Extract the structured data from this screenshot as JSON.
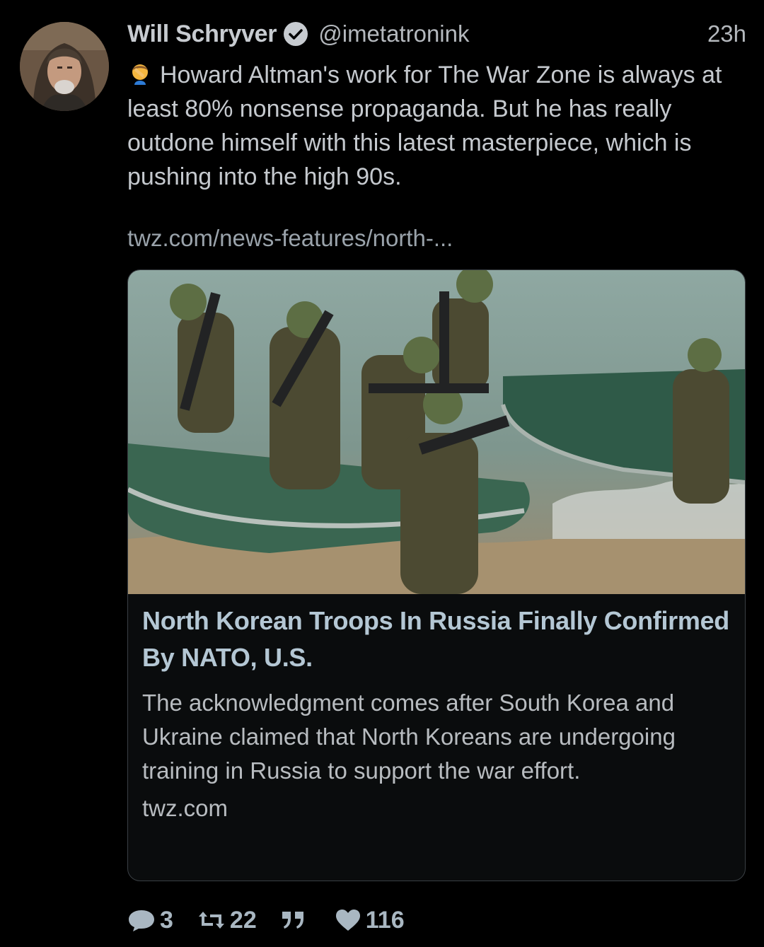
{
  "author": {
    "display_name": "Will Schryver",
    "handle": "@imetatronink",
    "verified": true,
    "avatar_icon": "avatar-photo"
  },
  "timestamp": "23h",
  "tweet": {
    "emoji_icon": "facepalm-emoji",
    "text": "Howard Altman's work for The War Zone is always at least 80% nonsense propaganda. But he has really outdone himself with this latest masterpiece, which is pushing into the high 90s.",
    "link": "twz.com/news-features/north-..."
  },
  "card": {
    "image_icon": "soldiers-landing-boats-photo",
    "headline": "North Korean Troops In Russia Finally Confirmed By NATO, U.S.",
    "description": "The acknowledgment comes after South Korea and Ukraine claimed that North Koreans are undergoing training in Russia to support the war effort.",
    "domain": "twz.com"
  },
  "actions": {
    "replies": "3",
    "retweets": "22",
    "quotes": "",
    "likes": "116"
  },
  "colors": {
    "background": "#000000",
    "accent": "#a9b7c2",
    "headline": "#b4c7d4"
  }
}
